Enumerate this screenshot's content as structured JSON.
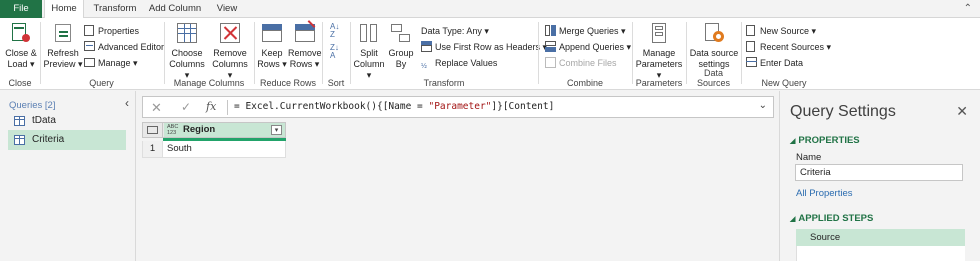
{
  "tabs": [
    {
      "label": "File"
    },
    {
      "label": "Home"
    },
    {
      "label": "Transform"
    },
    {
      "label": "Add Column"
    },
    {
      "label": "View"
    }
  ],
  "ribbon": {
    "close": {
      "close_load": [
        "Close &",
        "Load ▾"
      ],
      "group": "Close"
    },
    "query": {
      "refresh": [
        "Refresh",
        "Preview ▾"
      ],
      "properties": "Properties",
      "advanced_editor": "Advanced Editor",
      "manage": "Manage ▾",
      "group": "Query"
    },
    "manage_columns": {
      "choose": [
        "Choose",
        "Columns ▾"
      ],
      "remove": [
        "Remove",
        "Columns ▾"
      ],
      "group": "Manage Columns"
    },
    "reduce_rows": {
      "keep": [
        "Keep",
        "Rows ▾"
      ],
      "remove": [
        "Remove",
        "Rows ▾"
      ],
      "group": "Reduce Rows"
    },
    "sort": {
      "group": "Sort"
    },
    "transform": {
      "split": [
        "Split",
        "Column ▾"
      ],
      "group_by": [
        "Group",
        "By"
      ],
      "data_type": "Data Type: Any ▾",
      "first_row": "Use First Row as Headers ▾",
      "replace": "Replace Values",
      "group": "Transform"
    },
    "combine": {
      "merge": "Merge Queries ▾",
      "append": "Append Queries ▾",
      "combine_files": "Combine Files",
      "group": "Combine"
    },
    "parameters": {
      "manage": [
        "Manage",
        "Parameters ▾"
      ],
      "group": "Parameters"
    },
    "data_sources": {
      "settings": [
        "Data source",
        "settings"
      ],
      "group": "Data Sources"
    },
    "new_query": {
      "new_source": "New Source ▾",
      "recent": "Recent Sources ▾",
      "enter_data": "Enter Data",
      "group": "New Query"
    }
  },
  "queries_panel": {
    "heading": "Queries [2]",
    "items": [
      {
        "label": "tData"
      },
      {
        "label": "Criteria"
      }
    ]
  },
  "formula_bar": {
    "prefix": "= Excel.CurrentWorkbook(){[Name = ",
    "string": "\"Parameter\"",
    "suffix": "]}[Content]"
  },
  "grid": {
    "column_type": [
      "ABC",
      "123"
    ],
    "column_name": "Region",
    "rows": [
      {
        "num": "1",
        "value": "South"
      }
    ]
  },
  "query_settings": {
    "title": "Query Settings",
    "properties_heading": "PROPERTIES",
    "name_label": "Name",
    "name_value": "Criteria",
    "all_properties": "All Properties",
    "applied_steps_heading": "APPLIED STEPS",
    "steps": [
      {
        "label": "Source"
      }
    ]
  },
  "colors": {
    "accent": "#217346",
    "selection": "#c8e6d4",
    "column_bar": "#22a36a"
  }
}
